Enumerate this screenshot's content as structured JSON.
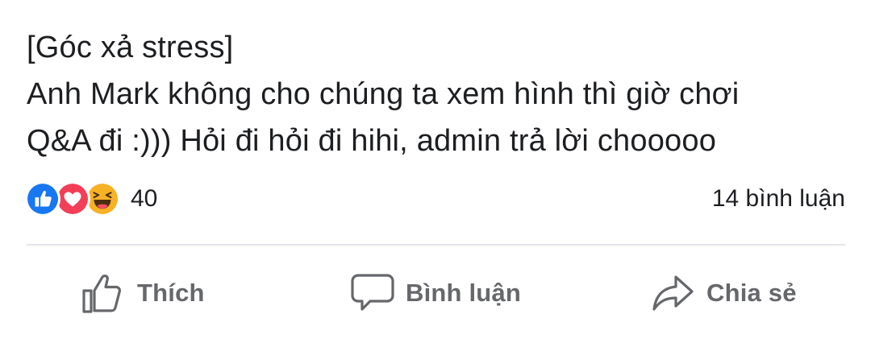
{
  "post": {
    "text_lines": [
      "[Góc xả stress]",
      "Anh Mark không cho chúng ta xem hình thì giờ chơi",
      "Q&A đi :))) Hỏi đi hỏi đi hihi, admin trả lời chooooo"
    ]
  },
  "reactions": {
    "icons": [
      "like-icon",
      "love-icon",
      "haha-icon"
    ],
    "count": "40",
    "colors": {
      "like": "#1877f2",
      "love": "#f33e58",
      "haha": "#f7b125"
    }
  },
  "comments": {
    "count_label": "14 bình luận"
  },
  "actions": {
    "like_label": "Thích",
    "comment_label": "Bình luận",
    "share_label": "Chia sẻ",
    "icons": [
      "thumbs-up-outline-icon",
      "speech-bubble-icon",
      "share-arrow-icon"
    ],
    "color": "#65676b"
  }
}
